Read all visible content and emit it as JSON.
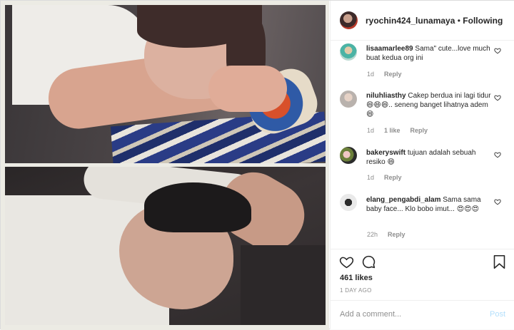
{
  "header": {
    "username": "ryochin424_lunamaya",
    "separator": "•",
    "follow_status": "Following"
  },
  "comments": [
    {
      "username": "lisaamarlee89",
      "text": "Sama\" cute...love much buat kedua org ini",
      "time": "1d",
      "likes": "",
      "reply": "Reply"
    },
    {
      "username": "niluhliasthy",
      "text": "Cakep berdua ini lagi tidur 😄😄😄.. seneng banget lihatnya adem 😄",
      "time": "1d",
      "likes": "1 like",
      "reply": "Reply"
    },
    {
      "username": "bakeryswift",
      "text": "tujuan adalah sebuah resiko 😄",
      "time": "1d",
      "likes": "",
      "reply": "Reply"
    },
    {
      "username": "elang_pengabdi_alam",
      "text": "Sama sama baby face... Klo bobo imut... 😍😍😍",
      "time": "22h",
      "likes": "",
      "reply": "Reply"
    }
  ],
  "actions": {
    "like_count": "461 likes",
    "time_ago": "1 DAY AGO"
  },
  "add_comment": {
    "placeholder": "Add a comment...",
    "post_label": "Post"
  },
  "icons": {
    "like": "heart-icon",
    "comment": "comment-bubble-icon",
    "save": "bookmark-icon",
    "comment_like": "small-heart-icon"
  },
  "colors": {
    "accent_disabled": "#b2dffc",
    "text_primary": "#262626",
    "text_secondary": "#8e8e8e",
    "border": "#efefef"
  }
}
